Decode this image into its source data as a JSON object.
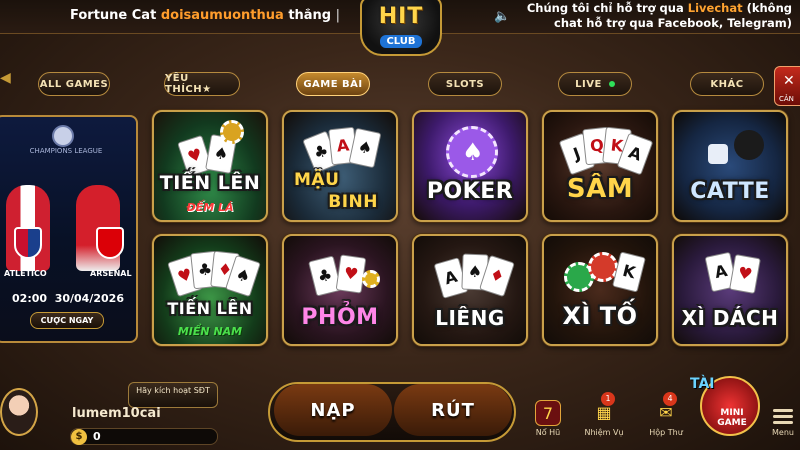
{
  "header": {
    "ticker": {
      "prefix": "Fortune Cat",
      "name": "doisaumuonthua",
      "suffix": "thắng",
      "sep": "|"
    },
    "logo": {
      "main": "HIT",
      "sub": "CLUB"
    },
    "support": {
      "line1_a": "Chúng tôi chỉ hỗ trợ qua ",
      "line1_b": "Livechat",
      "line1_c": " (không",
      "line2": "chat hỗ trợ qua Facebook, Telegram)"
    }
  },
  "tabs": [
    {
      "label": "ALL GAMES"
    },
    {
      "label": "YÊU THÍCH★"
    },
    {
      "label": "GAME BÀI"
    },
    {
      "label": "SLOTS"
    },
    {
      "label": "LIVE"
    },
    {
      "label": "KHÁC"
    }
  ],
  "exit": {
    "label": "CẢN"
  },
  "promo": {
    "league": "CHAMPIONS LEAGUE",
    "team1": "ATLETICO",
    "team2": "ARSENAL",
    "time": "02:00",
    "date": "30/04/2026",
    "bet_label": "CƯỢC NGAY"
  },
  "games": [
    {
      "title": "TIẾN LÊN",
      "subtitle": "ĐẾM LÁ"
    },
    {
      "title": "MẬU",
      "subtitle": "BINH"
    },
    {
      "title": "POKER"
    },
    {
      "title": "SÂM"
    },
    {
      "title": "CATTE"
    },
    {
      "title": "TIẾN LÊN",
      "subtitle": "MIỀN NAM"
    },
    {
      "title": "PHỎM"
    },
    {
      "title": "LIÊNG"
    },
    {
      "title": "XÌ TỐ"
    },
    {
      "title": "XÌ DÁCH"
    }
  ],
  "user": {
    "activate": "Hãy kích hoạt SĐT",
    "username": "lumem10cai",
    "balance": "0",
    "coin_symbol": "$"
  },
  "actions": {
    "nap": "NẠP",
    "rut": "RÚT"
  },
  "nav": [
    {
      "label": "Nổ Hũ",
      "icon": "jackpot-icon",
      "glyph": "7"
    },
    {
      "label": "Nhiệm Vụ",
      "icon": "gift-icon",
      "glyph": "🎁",
      "badge": "1"
    },
    {
      "label": "Hộp Thư",
      "icon": "mail-icon",
      "glyph": "✉",
      "badge": "4"
    },
    {
      "label": "Menu",
      "icon": "menu-icon"
    }
  ],
  "mini_game": {
    "tai": "TÀI",
    "label1": "MINI",
    "label2": "GAME"
  },
  "colors": {
    "accent": "#c59a36",
    "highlight": "#ff9d2c",
    "live_dot": "#2fe05a"
  }
}
